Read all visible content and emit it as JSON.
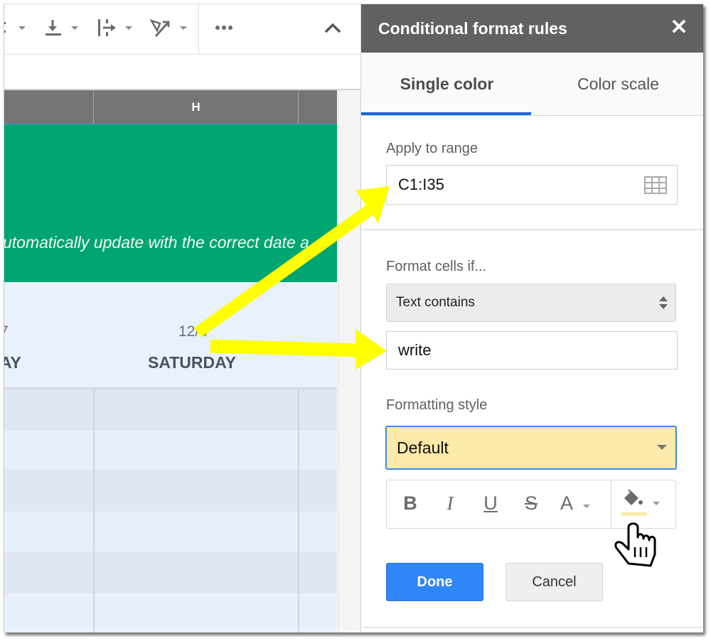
{
  "toolbar": {
    "icons": [
      {
        "name": "align-partial-icon"
      },
      {
        "name": "vertical-align-bottom-icon"
      },
      {
        "name": "text-wrapping-icon"
      },
      {
        "name": "text-rotation-icon"
      },
      {
        "name": "more-icon",
        "glyph": "•••"
      },
      {
        "name": "collapse-icon",
        "glyph": "^"
      }
    ]
  },
  "sheet": {
    "columns": [
      {
        "label": ""
      },
      {
        "label": "H"
      },
      {
        "label": ""
      }
    ],
    "banner_text": "utomatically update with the correct date a",
    "days": [
      {
        "num": "7",
        "name": "AY"
      },
      {
        "num": "12/3",
        "name": "SATURDAY"
      }
    ],
    "colors": {
      "banner": "#00a572",
      "header": "#757575"
    }
  },
  "panel": {
    "title": "Conditional format rules",
    "close_glyph": "✕",
    "tabs": [
      {
        "label": "Single color",
        "active": true
      },
      {
        "label": "Color scale",
        "active": false
      }
    ],
    "apply_range": {
      "label": "Apply to range",
      "value": "C1:I35"
    },
    "format_cells": {
      "label": "Format cells if...",
      "condition": "Text contains",
      "value": "write"
    },
    "formatting_style": {
      "label": "Formatting style",
      "selected": "Default",
      "fill_color": "#fde9a9",
      "buttons": [
        {
          "name": "bold",
          "glyph": "B"
        },
        {
          "name": "italic",
          "glyph": "I"
        },
        {
          "name": "underline",
          "glyph": "U"
        },
        {
          "name": "strikethrough",
          "glyph": "S"
        },
        {
          "name": "text-color",
          "glyph": "A"
        },
        {
          "name": "fill-color",
          "glyph": ""
        }
      ]
    },
    "actions": {
      "done_label": "Done",
      "cancel_label": "Cancel"
    },
    "accent_color": "#1a66d8"
  },
  "annotations": {
    "arrow_color": "#ffff00"
  }
}
